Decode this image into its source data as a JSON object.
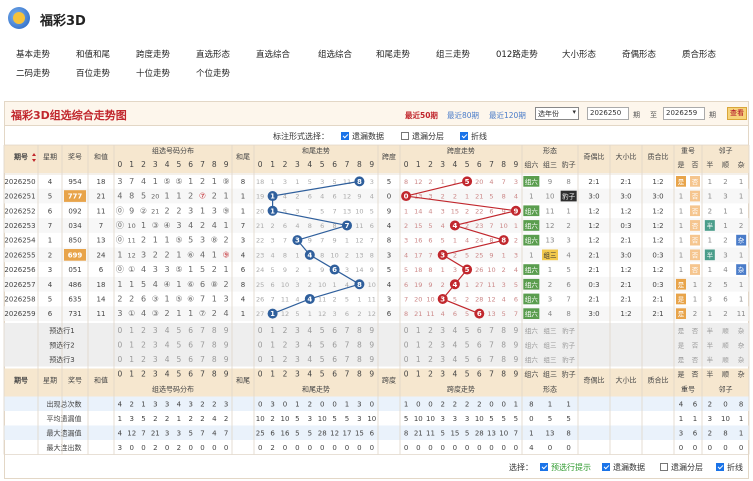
{
  "app": {
    "title": "福彩3D"
  },
  "nav": {
    "row1": [
      "基本走势",
      "和值和尾",
      "跨度走势",
      "直选形态",
      "直选综合",
      "组选综合",
      "和尾走势",
      "组三走势",
      "012路走势",
      "大小形态",
      "奇偶形态",
      "质合形态"
    ],
    "row2": [
      "二码走势",
      "百位走势",
      "十位走势",
      "个位走势"
    ]
  },
  "panel": {
    "title": "福彩3D组选综合走势图",
    "periods": [
      "最近50期",
      "最近80期",
      "最近120期"
    ],
    "year_select": "选年份",
    "from": "2026250",
    "from_label": "期",
    "to_sep": "至",
    "to": "2026259",
    "to_label": "期",
    "view_button": "查看"
  },
  "options": {
    "label": "标注形式选择：",
    "items": [
      {
        "label": "遗漏数据",
        "checked": true
      },
      {
        "label": "遗漏分层",
        "checked": false
      },
      {
        "label": "折线",
        "checked": true
      }
    ]
  },
  "table": {
    "group_headers": {
      "issue": "期号",
      "week": "星期",
      "prize": "奖号",
      "sum": "和值",
      "dist": "组选号码分布",
      "tail": "和尾",
      "tail_trend": "和尾走势",
      "span": "跨度",
      "span_trend": "跨度走势",
      "shape": "形态",
      "odd_even": "奇偶比",
      "big_small": "大小比",
      "prime": "质合比",
      "repeat": "重号",
      "pair": "邻子"
    },
    "shape_sub": [
      "组六",
      "组三",
      "豹子"
    ],
    "repeat_sub": [
      "是",
      "否"
    ],
    "pair_sub": [
      "半",
      "顺",
      "杂"
    ],
    "digits": [
      "0",
      "1",
      "2",
      "3",
      "4",
      "5",
      "6",
      "7",
      "8",
      "9"
    ],
    "rows": [
      {
        "issue": "2026250",
        "week": "4",
        "prize": "954",
        "sum": "18",
        "dist": [
          "3",
          "7",
          "4",
          "1",
          "⑤",
          "⑤",
          "1",
          "2",
          "1",
          "⑨"
        ],
        "tail": "8",
        "tail_trend": [
          "18",
          "1",
          "3",
          "1",
          "5",
          "3",
          "5",
          "11",
          "8",
          "3"
        ],
        "span": "5",
        "span_trend": [
          "8",
          "12",
          "2",
          "1",
          "1",
          "5",
          "20",
          "4",
          "7",
          "3"
        ],
        "shape": [
          "组六",
          "9",
          "8"
        ],
        "odd_even": "2:1",
        "big_small": "2:1",
        "prime": "1:2",
        "repeat": [
          "是",
          "否"
        ],
        "pair": [
          "1",
          "2",
          "1"
        ]
      },
      {
        "issue": "2026251",
        "week": "5",
        "prize": "777",
        "sum": "21",
        "dist": [
          "4",
          "8",
          "5",
          "20",
          "1",
          "1",
          "2",
          "⑦",
          "2",
          "1"
        ],
        "tail": "1",
        "tail_trend": [
          "19",
          "1",
          "4",
          "2",
          "6",
          "4",
          "6",
          "12",
          "9",
          "4"
        ],
        "span": "0",
        "span_trend": [
          "0",
          "13",
          "3",
          "2",
          "2",
          "1",
          "21",
          "5",
          "8",
          "4"
        ],
        "shape": [
          "1",
          "10",
          "豹子"
        ],
        "odd_even": "3:0",
        "big_small": "3:0",
        "prime": "3:0",
        "repeat": [
          "1",
          "否"
        ],
        "pair": [
          "1",
          "3",
          "1"
        ]
      },
      {
        "issue": "2026252",
        "week": "6",
        "prize": "092",
        "sum": "11",
        "dist": [
          "⓪",
          "9",
          "②",
          "21",
          "2",
          "2",
          "3",
          "1",
          "3",
          "⑨"
        ],
        "tail": "1",
        "tail_trend": [
          "20",
          "1",
          "5",
          "3",
          "7",
          "5",
          "7",
          "13",
          "10",
          "5"
        ],
        "span": "9",
        "span_trend": [
          "1",
          "14",
          "4",
          "3",
          "15",
          "2",
          "22",
          "6",
          "9",
          "9"
        ],
        "shape": [
          "组六",
          "11",
          "1"
        ],
        "odd_even": "1:2",
        "big_small": "1:2",
        "prime": "1:2",
        "repeat": [
          "1",
          "否"
        ],
        "pair": [
          "2",
          "1",
          "1"
        ]
      },
      {
        "issue": "2026253",
        "week": "7",
        "prize": "034",
        "sum": "7",
        "dist": [
          "⓪",
          "10",
          "1",
          "③",
          "④",
          "3",
          "4",
          "2",
          "4",
          "1"
        ],
        "tail": "7",
        "tail_trend": [
          "21",
          "2",
          "6",
          "4",
          "8",
          "6",
          "8",
          "7",
          "11",
          "6"
        ],
        "span": "4",
        "span_trend": [
          "2",
          "15",
          "5",
          "4",
          "4",
          "2",
          "23",
          "7",
          "10",
          "1"
        ],
        "shape": [
          "组六",
          "12",
          "2"
        ],
        "odd_even": "1:2",
        "big_small": "0:3",
        "prime": "1:2",
        "repeat": [
          "1",
          "否"
        ],
        "pair": [
          "半",
          "1",
          "2"
        ]
      },
      {
        "issue": "2026254",
        "week": "1",
        "prize": "850",
        "sum": "13",
        "dist": [
          "⓪",
          "11",
          "2",
          "1",
          "1",
          "⑤",
          "5",
          "3",
          "⑧",
          "2"
        ],
        "tail": "3",
        "tail_trend": [
          "22",
          "3",
          "7",
          "3",
          "9",
          "7",
          "9",
          "1",
          "12",
          "7"
        ],
        "span": "8",
        "span_trend": [
          "3",
          "16",
          "6",
          "5",
          "1",
          "4",
          "24",
          "8",
          "8",
          "2"
        ],
        "shape": [
          "组六",
          "13",
          "3"
        ],
        "odd_even": "1:2",
        "big_small": "2:1",
        "prime": "1:2",
        "repeat": [
          "1",
          "否"
        ],
        "pair": [
          "1",
          "2",
          "杂"
        ]
      },
      {
        "issue": "2026255",
        "week": "2",
        "prize": "699",
        "sum": "24",
        "dist": [
          "1",
          "12",
          "3",
          "2",
          "2",
          "1",
          "⑥",
          "4",
          "1",
          "⑨"
        ],
        "tail": "4",
        "tail_trend": [
          "23",
          "4",
          "8",
          "1",
          "4",
          "8",
          "10",
          "2",
          "13",
          "8"
        ],
        "span": "3",
        "span_trend": [
          "4",
          "17",
          "7",
          "3",
          "2",
          "5",
          "25",
          "9",
          "1",
          "3"
        ],
        "shape": [
          "1",
          "组三",
          "4"
        ],
        "odd_even": "2:1",
        "big_small": "3:0",
        "prime": "0:3",
        "repeat": [
          "1",
          "否"
        ],
        "pair": [
          "半",
          "3",
          "1"
        ]
      },
      {
        "issue": "2026256",
        "week": "3",
        "prize": "051",
        "sum": "6",
        "dist": [
          "⓪",
          "①",
          "4",
          "3",
          "3",
          "⑤",
          "1",
          "5",
          "2",
          "1"
        ],
        "tail": "6",
        "tail_trend": [
          "24",
          "5",
          "9",
          "2",
          "1",
          "9",
          "6",
          "3",
          "14",
          "9"
        ],
        "span": "5",
        "span_trend": [
          "5",
          "18",
          "8",
          "1",
          "3",
          "5",
          "26",
          "10",
          "2",
          "4"
        ],
        "shape": [
          "组六",
          "1",
          "5"
        ],
        "odd_even": "2:1",
        "big_small": "1:2",
        "prime": "1:2",
        "repeat": [
          "1",
          "否"
        ],
        "pair": [
          "1",
          "4",
          "杂"
        ]
      },
      {
        "issue": "2026257",
        "week": "4",
        "prize": "486",
        "sum": "18",
        "dist": [
          "1",
          "1",
          "5",
          "4",
          "④",
          "1",
          "⑥",
          "6",
          "⑧",
          "2"
        ],
        "tail": "8",
        "tail_trend": [
          "25",
          "6",
          "10",
          "3",
          "2",
          "10",
          "1",
          "4",
          "8",
          "10"
        ],
        "span": "4",
        "span_trend": [
          "6",
          "19",
          "9",
          "2",
          "4",
          "1",
          "27",
          "11",
          "3",
          "5"
        ],
        "shape": [
          "组六",
          "2",
          "6"
        ],
        "odd_even": "0:3",
        "big_small": "2:1",
        "prime": "0:3",
        "repeat": [
          "是",
          "1"
        ],
        "pair": [
          "2",
          "5",
          "1"
        ]
      },
      {
        "issue": "2026258",
        "week": "5",
        "prize": "635",
        "sum": "14",
        "dist": [
          "2",
          "2",
          "6",
          "③",
          "1",
          "⑤",
          "⑥",
          "7",
          "1",
          "3"
        ],
        "tail": "4",
        "tail_trend": [
          "26",
          "7",
          "11",
          "4",
          "4",
          "11",
          "2",
          "5",
          "1",
          "11"
        ],
        "span": "3",
        "span_trend": [
          "7",
          "20",
          "10",
          "3",
          "5",
          "2",
          "28",
          "12",
          "4",
          "6"
        ],
        "shape": [
          "组六",
          "3",
          "7"
        ],
        "odd_even": "2:1",
        "big_small": "2:1",
        "prime": "2:1",
        "repeat": [
          "是",
          "1"
        ],
        "pair": [
          "3",
          "6",
          "1"
        ]
      },
      {
        "issue": "2026259",
        "week": "6",
        "prize": "731",
        "sum": "11",
        "dist": [
          "3",
          "①",
          "4",
          "③",
          "2",
          "1",
          "1",
          "⑦",
          "2",
          "4"
        ],
        "tail": "1",
        "tail_trend": [
          "27",
          "1",
          "12",
          "5",
          "1",
          "12",
          "3",
          "6",
          "2",
          "12"
        ],
        "span": "6",
        "span_trend": [
          "8",
          "21",
          "11",
          "4",
          "6",
          "5",
          "29",
          "13",
          "5",
          "7"
        ],
        "shape": [
          "组六",
          "4",
          "8"
        ],
        "odd_even": "3:0",
        "big_small": "1:2",
        "prime": "2:1",
        "repeat": [
          "是",
          "2"
        ],
        "pair": [
          "1",
          "2",
          "11"
        ]
      }
    ],
    "preselect_rows": [
      "预选行1",
      "预选行2",
      "预选行3"
    ],
    "preselect_shape": [
      "组六",
      "组三",
      "豹子"
    ],
    "preselect_repeat": [
      "是",
      "否"
    ],
    "preselect_pair": [
      "半",
      "顺",
      "杂"
    ],
    "stats": [
      {
        "label": "出现总次数",
        "dist": [
          "4",
          "2",
          "1",
          "3",
          "3",
          "4",
          "3",
          "2",
          "2",
          "3"
        ],
        "tail_trend": [
          "0",
          "3",
          "0",
          "1",
          "2",
          "0",
          "0",
          "1",
          "3",
          "0"
        ],
        "span_trend": [
          "1",
          "0",
          "0",
          "2",
          "2",
          "2",
          "2",
          "0",
          "0",
          "1"
        ],
        "shape": [
          "8",
          "1",
          "1"
        ],
        "repeat": [
          "4",
          "6"
        ],
        "pair": [
          "2",
          "0",
          "8"
        ]
      },
      {
        "label": "平均遗漏值",
        "dist": [
          "1",
          "3",
          "5",
          "2",
          "2",
          "1",
          "2",
          "2",
          "4",
          "2"
        ],
        "tail_trend": [
          "10",
          "2",
          "10",
          "5",
          "3",
          "10",
          "5",
          "5",
          "3",
          "10"
        ],
        "span_trend": [
          "5",
          "10",
          "10",
          "3",
          "3",
          "3",
          "10",
          "5",
          "5",
          "5"
        ],
        "shape": [
          "0",
          "5",
          "5"
        ],
        "repeat": [
          "1",
          "1"
        ],
        "pair": [
          "3",
          "10",
          "1"
        ]
      },
      {
        "label": "最大遗漏值",
        "dist": [
          "4",
          "12",
          "7",
          "21",
          "3",
          "3",
          "5",
          "7",
          "4",
          "7"
        ],
        "tail_trend": [
          "25",
          "6",
          "16",
          "5",
          "5",
          "28",
          "12",
          "17",
          "15",
          "6"
        ],
        "span_trend": [
          "8",
          "21",
          "11",
          "5",
          "15",
          "5",
          "28",
          "13",
          "10",
          "7"
        ],
        "shape": [
          "1",
          "13",
          "8"
        ],
        "repeat": [
          "3",
          "6"
        ],
        "pair": [
          "2",
          "8",
          "1"
        ]
      },
      {
        "label": "最大连出数",
        "dist": [
          "3",
          "0",
          "0",
          "2",
          "0",
          "2",
          "0",
          "0",
          "0",
          "0"
        ],
        "tail_trend": [
          "0",
          "2",
          "0",
          "0",
          "0",
          "0",
          "0",
          "0",
          "0",
          "0"
        ],
        "span_trend": [
          "0",
          "0",
          "0",
          "0",
          "0",
          "0",
          "0",
          "0",
          "0",
          "0"
        ],
        "shape": [
          "4",
          "0",
          "0"
        ],
        "repeat": [
          "0",
          "0"
        ],
        "pair": [
          "0",
          "0",
          "0"
        ]
      }
    ],
    "tail_hits": [
      8,
      1,
      1,
      7,
      3,
      4,
      6,
      8,
      4,
      1
    ],
    "span_hits": [
      5,
      0,
      9,
      4,
      8,
      3,
      5,
      4,
      3,
      6
    ]
  },
  "footer": {
    "label": "选择：",
    "items": [
      {
        "label": "预选行提示",
        "checked": true
      },
      {
        "label": "遗漏数据",
        "checked": true
      },
      {
        "label": "遗漏分层",
        "checked": false
      },
      {
        "label": "折线",
        "checked": true
      }
    ]
  },
  "colors": {
    "accent_red": "#c1272d",
    "tail_line": "#2f5f9c",
    "span_line": "#c1272d",
    "header_bg": "#f6e7cf",
    "grid_line": "#e0d6c8",
    "shape_green": "#5a9d4e",
    "repeat_orange": "#f0a050"
  }
}
